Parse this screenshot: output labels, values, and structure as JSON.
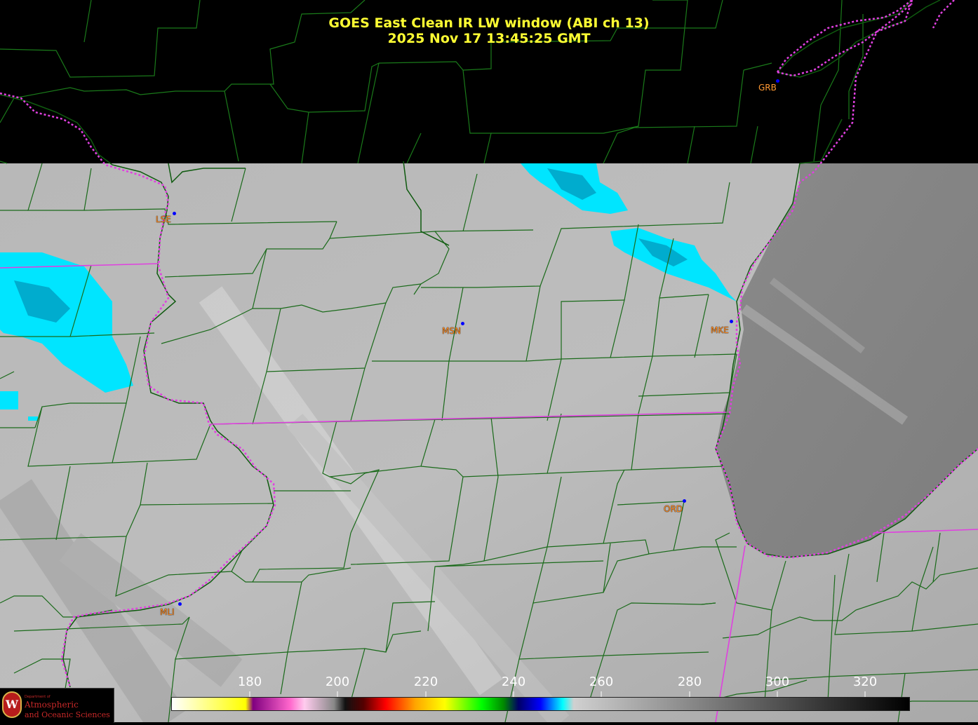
{
  "map": {
    "title_line1": "GOES East Clean IR LW window (ABI ch 13)",
    "title_line2": "2025 Nov 17  13:45:25 GMT",
    "stations": [
      {
        "id": "GRB"
      },
      {
        "id": "LSE"
      },
      {
        "id": "MSN"
      },
      {
        "id": "MKE"
      },
      {
        "id": "ORD"
      },
      {
        "id": "MLI"
      }
    ],
    "colors": {
      "county_lines": "#1a7a1a",
      "state_borders": "#e040e0",
      "title": "#ffff33",
      "station_label": "#ff9933",
      "station_dot": "#0000ff",
      "cold_cloud": "#00e5ff",
      "no_data": "#000000"
    }
  },
  "colorbar": {
    "ticks": [
      "180",
      "200",
      "220",
      "240",
      "260",
      "280",
      "300",
      "320"
    ]
  },
  "logo": {
    "department": "Department of",
    "line1": "Atmospheric",
    "line2": "and Oceanic Sciences"
  }
}
